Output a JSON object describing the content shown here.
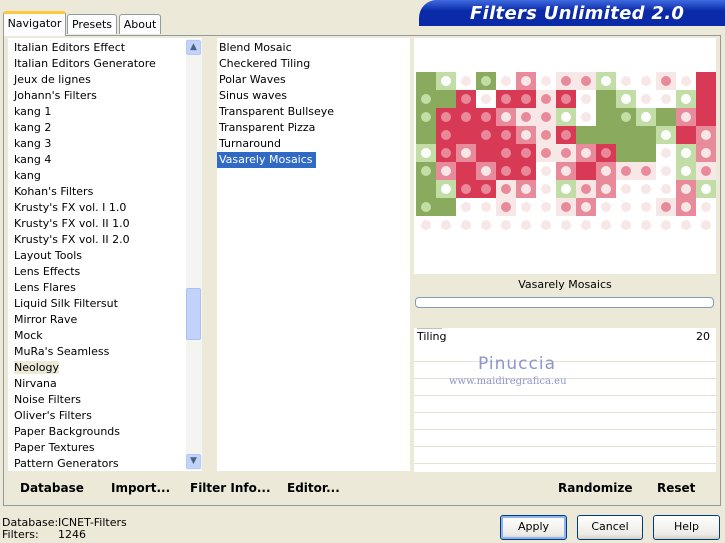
{
  "banner": {
    "title": "Filters Unlimited 2.0"
  },
  "tabs": [
    {
      "label": "Navigator"
    },
    {
      "label": "Presets"
    },
    {
      "label": "About"
    }
  ],
  "categories": {
    "items": [
      "Italian Editors Effect",
      "Italian Editors Generatore",
      "Jeux de lignes",
      "Johann's Filters",
      "kang 1",
      "kang 2",
      "kang 3",
      "kang 4",
      "kang",
      "Kohan's Filters",
      "Krusty's FX vol. I 1.0",
      "Krusty's FX vol. II 1.0",
      "Krusty's FX vol. II 2.0",
      "Layout Tools",
      "Lens Effects",
      "Lens Flares",
      "Liquid Silk Filtersut",
      "Mirror Rave",
      "Mock",
      "MuRa's Seamless",
      "Neology",
      "Nirvana",
      "Noise Filters",
      "Oliver's Filters",
      "Paper Backgrounds",
      "Paper Textures",
      "Pattern Generators"
    ],
    "selected": "Neology"
  },
  "filters": {
    "items": [
      "Blend Mosaic",
      "Checkered Tiling",
      "Polar Waves",
      "Sinus waves",
      "Transparent Bullseye",
      "Transparent Pizza",
      "Turnaround",
      "Vasarely Mosaics"
    ],
    "selected": "Vasarely Mosaics"
  },
  "preview": {
    "filter_name": "Vasarely Mosaics",
    "watermark_name": "Pinuccia",
    "watermark_url": "www.maidiregrafica.eu",
    "colors": {
      "green": "#8aaa5e",
      "light_green": "#c3dda6",
      "pink": "#e88a9a",
      "red": "#d83a55",
      "pale": "#f7e7e7",
      "white": "#ffffff"
    }
  },
  "parameters": [
    {
      "label": "Tiling",
      "value": "20",
      "level": 20
    }
  ],
  "toolbar": {
    "database": "Database",
    "import": "Import...",
    "filter_info": "Filter Info...",
    "editor": "Editor...",
    "randomize": "Randomize",
    "reset": "Reset"
  },
  "status": {
    "database_label": "Database:",
    "database_value": "ICNET-Filters",
    "filters_label": "Filters:",
    "filters_value": "1246"
  },
  "buttons": {
    "apply": "Apply",
    "cancel": "Cancel",
    "help": "Help"
  }
}
